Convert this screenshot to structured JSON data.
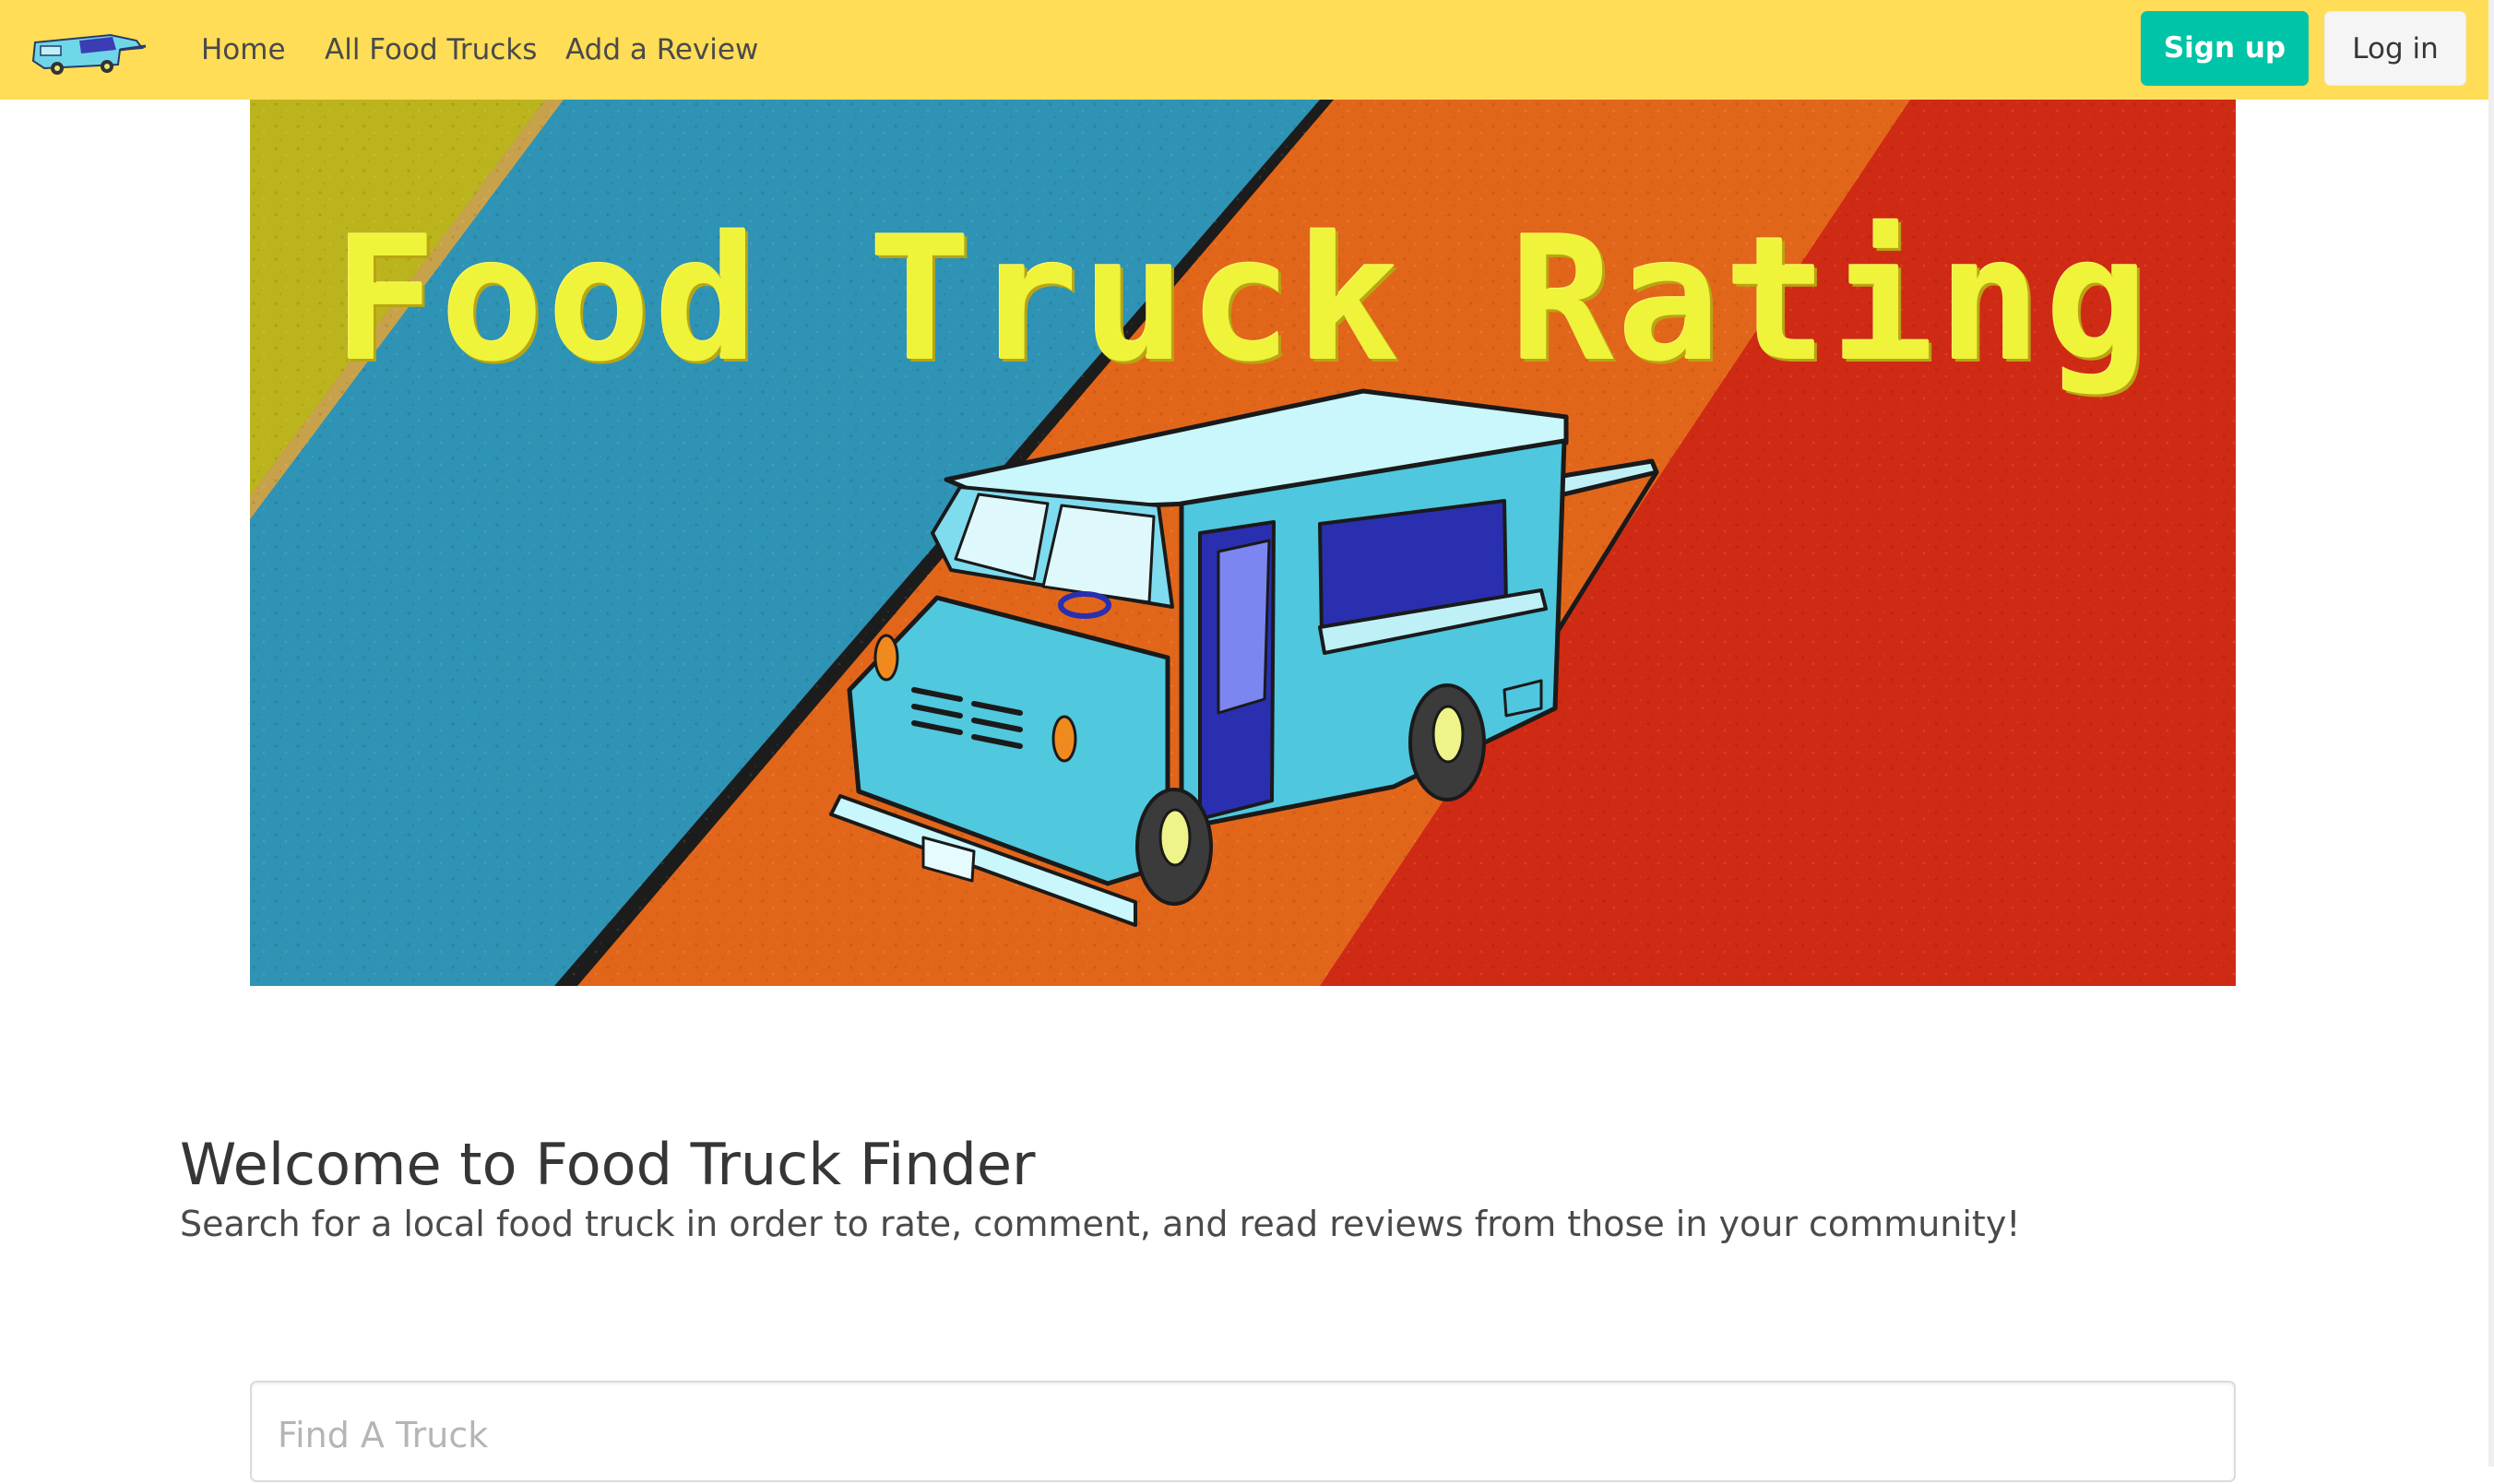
{
  "navbar": {
    "logo_icon": "food-truck-logo-icon",
    "items": [
      {
        "label": "Home"
      },
      {
        "label": "All Food Trucks"
      },
      {
        "label": "Add a Review"
      }
    ],
    "signup_label": "Sign up",
    "login_label": "Log in",
    "background_color": "#ffdd57",
    "signup_color": "#00c4a7"
  },
  "hero": {
    "banner_text": "Food Truck Rating",
    "image_subject": "food-truck-illustration"
  },
  "welcome": {
    "title": "Welcome to Food Truck Finder",
    "subtitle": "Search for a local food truck in order to rate, comment, and read reviews from those in your community!"
  },
  "search": {
    "placeholder": "Find A Truck",
    "value": ""
  }
}
